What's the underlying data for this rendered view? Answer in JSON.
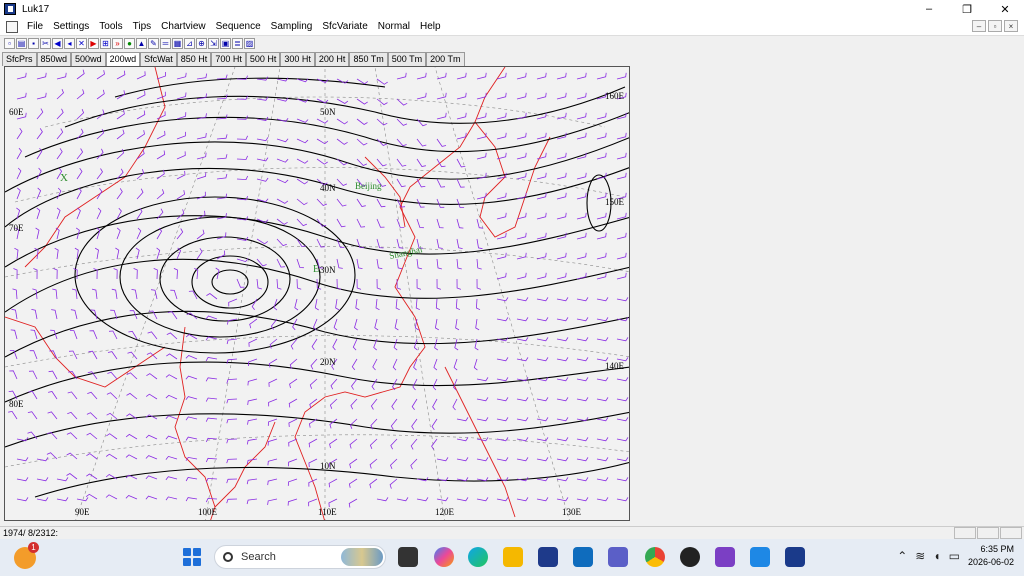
{
  "window": {
    "title": "Luk17"
  },
  "window_controls": {
    "minimize": "–",
    "maximize": "❐",
    "close": "✕"
  },
  "menu": {
    "items": [
      "File",
      "Settings",
      "Tools",
      "Tips",
      "Chartview",
      "Sequence",
      "Sampling",
      "SfcVariate",
      "Normal",
      "Help"
    ]
  },
  "mdi_controls": [
    "–",
    "▫",
    "×"
  ],
  "toolbar_icons": [
    "new-icon",
    "open-icon",
    "save-icon",
    "first-icon",
    "prev-icon",
    "stop-icon",
    "play-icon",
    "next-icon",
    "fast-forward-icon",
    "grid-icon",
    "globe-icon",
    "pen-icon",
    "ruler-icon",
    "table-icon",
    "chart-icon",
    "zoom-icon",
    "export-icon",
    "camera-icon",
    "layers-icon"
  ],
  "tabs": {
    "items": [
      "SfcPrs",
      "850wd",
      "500wd",
      "200wd",
      "SfcWat",
      "850 Ht",
      "700 Ht",
      "500 Ht",
      "300 Ht",
      "200 Ht",
      "850 Tm",
      "500 Tm",
      "200 Tm"
    ],
    "active": "200wd"
  },
  "map": {
    "lat_labels": [
      "50N",
      "40N",
      "30N",
      "20N",
      "10N"
    ],
    "lon_labels_bottom": [
      "90E",
      "100E",
      "110E",
      "120E",
      "130E"
    ],
    "lon_labels_side": [
      "60E",
      "70E",
      "80E",
      "160E",
      "150E",
      "140E"
    ],
    "cities": [
      "Beijing",
      "Shanghai"
    ],
    "markers": [
      "X",
      "E"
    ],
    "colors": {
      "contour": "#000000",
      "wind": "#8a2be2",
      "coast": "#e02020",
      "grid": "#7a7a7a",
      "city": "#2a8a2a"
    }
  },
  "status": {
    "text": "1974/ 8/2312:"
  },
  "taskbar": {
    "badge": "1",
    "search_placeholder": "Search",
    "time": "6:35 PM",
    "date": "2026-06-02"
  }
}
